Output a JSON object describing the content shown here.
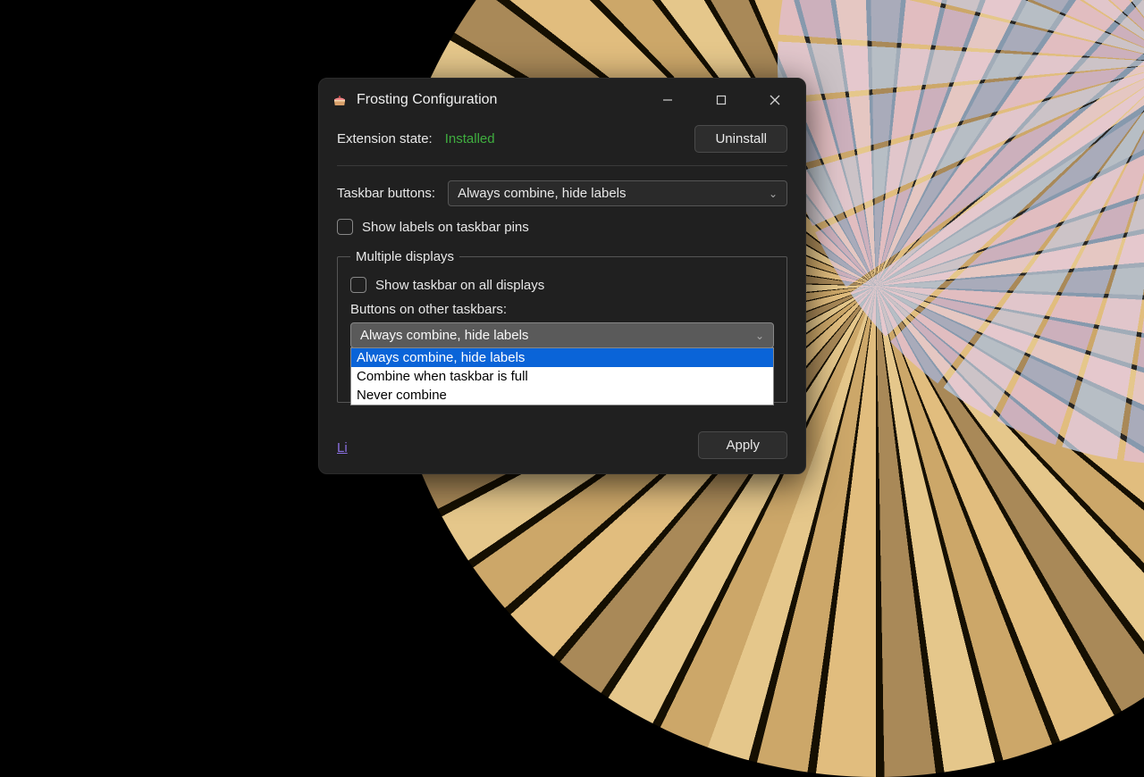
{
  "window": {
    "title": "Frosting Configuration",
    "app_icon": "cake-icon"
  },
  "header": {
    "state_label": "Extension state:",
    "state_value": "Installed",
    "uninstall_label": "Uninstall"
  },
  "taskbar": {
    "label": "Taskbar buttons:",
    "selected": "Always combine, hide labels",
    "show_labels_pins": "Show labels on taskbar pins"
  },
  "multi": {
    "legend": "Multiple displays",
    "show_all": "Show taskbar on all displays",
    "buttons_other_label": "Buttons on other taskbars:",
    "buttons_other_selected": "Always combine, hide labels",
    "options": [
      "Always combine, hide labels",
      "Combine when taskbar is full",
      "Never combine"
    ]
  },
  "footer": {
    "link_partial": "Li",
    "apply_label": "Apply"
  },
  "colors": {
    "accent_green": "#3fae3f",
    "selection_blue": "#0a64d8"
  }
}
